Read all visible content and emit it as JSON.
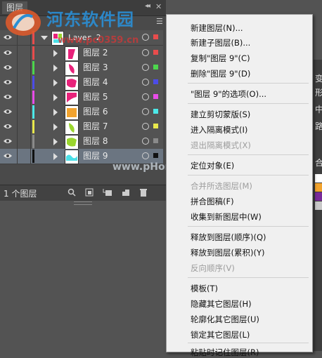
{
  "panel": {
    "tab_label": "图层",
    "collapse_glyph": "◂◂",
    "close_glyph": "✕",
    "menu_glyph": "☰",
    "parent_layer": {
      "name": "Layer 2",
      "color": "#e84c4c"
    },
    "layers": [
      {
        "name": "图层 2",
        "color": "#e84c4c",
        "thumb": "#e8227a",
        "shape": "stripe"
      },
      {
        "name": "图层 3",
        "color": "#4cd64c",
        "thumb": "#e8227a",
        "shape": "leaf"
      },
      {
        "name": "图层 4",
        "color": "#4c4ce8",
        "thumb": "#e8227a",
        "shape": "blob"
      },
      {
        "name": "图层 5",
        "color": "#e84ce8",
        "thumb": "#e8227a",
        "shape": "corner"
      },
      {
        "name": "图层 6",
        "color": "#4ce8e8",
        "thumb": "#f2a32e",
        "shape": "square"
      },
      {
        "name": "图层 7",
        "color": "#e8e84c",
        "thumb": "#9ad62e",
        "shape": "leaf"
      },
      {
        "name": "图层 8",
        "color": "#8a8a8a",
        "thumb": "#9ad62e",
        "shape": "blob"
      },
      {
        "name": "图层 9",
        "color": "#111111",
        "thumb": "#4ce0e8",
        "shape": "wave",
        "selected": true
      }
    ],
    "footer": {
      "count_label": "1 个图层",
      "icons": [
        "search-icon",
        "make-clip-mask-icon",
        "new-sublayer-icon",
        "new-layer-icon",
        "delete-icon"
      ]
    }
  },
  "watermark": {
    "title": "河东软件园",
    "url": "www.pc0359.cn",
    "center": "www.pHome.NET"
  },
  "side_panel": {
    "texts": [
      "变",
      "形",
      "中",
      "路",
      "合"
    ],
    "swatches": [
      "#ffffff",
      "#f2a32e",
      "#7a2a9a",
      "#c8c8c8"
    ]
  },
  "menu": {
    "items": [
      {
        "label": "新建图层(N)...",
        "disabled": false
      },
      {
        "label": "新建子图层(B)...",
        "disabled": false
      },
      {
        "label": "复制\"图层 9\"(C)",
        "disabled": false
      },
      {
        "label": "删除\"图层 9\"(D)",
        "disabled": false
      },
      {
        "label": "\"图层 9\"的选项(O)...",
        "disabled": false
      },
      {
        "label": "建立剪切蒙版(S)",
        "disabled": false
      },
      {
        "label": "进入隔离模式(I)",
        "disabled": false
      },
      {
        "label": "退出隔离模式(X)",
        "disabled": true
      },
      {
        "label": "定位对象(E)",
        "disabled": false
      },
      {
        "label": "合并所选图层(M)",
        "disabled": true
      },
      {
        "label": "拼合图稿(F)",
        "disabled": false
      },
      {
        "label": "收集到新图层中(W)",
        "disabled": false
      },
      {
        "label": "释放到图层(顺序)(Q)",
        "disabled": false
      },
      {
        "label": "释放到图层(累积)(Y)",
        "disabled": false
      },
      {
        "label": "反向顺序(V)",
        "disabled": true
      },
      {
        "label": "模板(T)",
        "disabled": false
      },
      {
        "label": "隐藏其它图层(H)",
        "disabled": false
      },
      {
        "label": "轮廓化其它图层(U)",
        "disabled": false
      },
      {
        "label": "锁定其它图层(L)",
        "disabled": false
      },
      {
        "label": "粘贴时记住图层(R)",
        "disabled": false
      }
    ]
  }
}
